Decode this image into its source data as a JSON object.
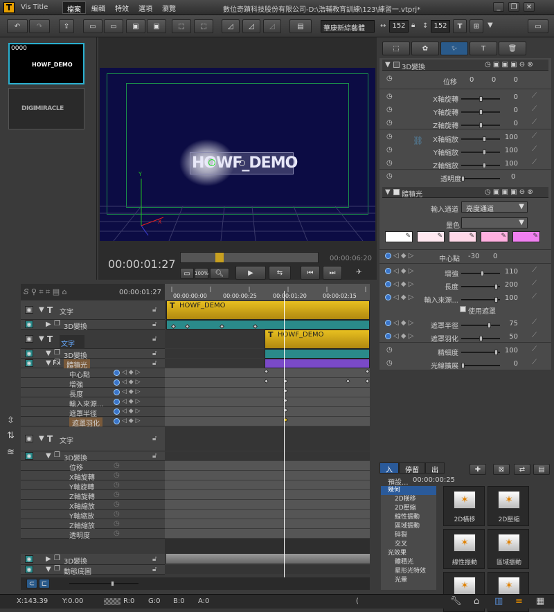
{
  "app": {
    "logo": "T",
    "title": "Vis Title",
    "menu": [
      "檔案",
      "編輯",
      "特效",
      "選項",
      "瀏覽"
    ],
    "window_title": "數位奇蹟科技股份有限公司-D:\\浩輔教育訓練\\123\\練習一.vtprj*"
  },
  "toolbar": {
    "font_name": "華康新綜藝體",
    "font_width": "152",
    "font_height": "152"
  },
  "thumbs": [
    {
      "index": "0000",
      "label": "HOWF_DEMO"
    },
    {
      "label": "DIGIMIRACLE"
    }
  ],
  "preview": {
    "text": "HOWF_DEMO",
    "timecode": "00:00:01:27",
    "end_time": "00:00:06:20",
    "zoom_badge": "100%",
    "axis_y": "Y",
    "axis_x": "X"
  },
  "right": {
    "section1_title": "3D變換",
    "position_label": "位移",
    "position_values": [
      "0",
      "0",
      "0"
    ],
    "rows1": [
      {
        "label": "X軸旋轉",
        "value": "0",
        "level": 0.5
      },
      {
        "label": "Y軸旋轉",
        "value": "0",
        "level": 0.5
      },
      {
        "label": "Z軸旋轉",
        "value": "0",
        "level": 0.5
      }
    ],
    "rows2": [
      {
        "label": "X軸縮放",
        "value": "100",
        "level": 0.6
      },
      {
        "label": "Y軸縮放",
        "value": "100",
        "level": 0.6
      },
      {
        "label": "Z軸縮放",
        "value": "100",
        "level": 0.6
      }
    ],
    "opacity_label": "透明度",
    "opacity_value": "0",
    "section2_title": "體積光",
    "input_channel_label": "輸入通道",
    "input_channel_value": "亮度通道",
    "color_label": "量色",
    "center_label": "中心點",
    "center_x": "-30",
    "center_y": "0",
    "rows3": [
      {
        "label": "增強",
        "value": "110",
        "level": 0.55
      },
      {
        "label": "長度",
        "value": "200",
        "level": 0.95
      },
      {
        "label": "輸入來源...",
        "value": "100",
        "level": 0.95
      }
    ],
    "use_mask_label": "使用遮罩",
    "rows4": [
      {
        "label": "遮罩半徑",
        "value": "75",
        "level": 0.75
      },
      {
        "label": "遮罩羽化",
        "value": "50",
        "level": 0.5
      }
    ],
    "rows5": [
      {
        "label": "精細度",
        "value": "100",
        "level": 0.95
      },
      {
        "label": "光線擴展",
        "value": "0",
        "level": 0.0
      }
    ],
    "swatches": [
      "#ffffff",
      "#ffe8f0",
      "#ffd8e8",
      "#ffb0e0",
      "#f080f0"
    ]
  },
  "timeline": {
    "header_time": "00:00:01:27",
    "ruler": [
      "00:00:00:00",
      "00:00:00:25",
      "00:00:01:20",
      "00:00:02:15"
    ],
    "clip1_label": "HOWF_DEMO",
    "clip2_label": "HOWF_DEMO",
    "tracks": [
      {
        "name": "文字",
        "indent": 0
      },
      {
        "name": "3D變換",
        "indent": 1
      },
      {
        "name": "文字",
        "indent": 0
      },
      {
        "name": "3D變換",
        "indent": 1
      },
      {
        "name": "體積光",
        "indent": 1
      },
      {
        "name": "中心點",
        "indent": 2
      },
      {
        "name": "增強",
        "indent": 2
      },
      {
        "name": "長度",
        "indent": 2
      },
      {
        "name": "輸入來源...",
        "indent": 2
      },
      {
        "name": "遮罩半徑",
        "indent": 2
      },
      {
        "name": "遮罩羽化",
        "indent": 2
      },
      {
        "name": "文字",
        "indent": 0
      },
      {
        "name": "3D變換",
        "indent": 1
      },
      {
        "name": "位移",
        "indent": 2
      },
      {
        "name": "X軸旋轉",
        "indent": 2
      },
      {
        "name": "Y軸旋轉",
        "indent": 2
      },
      {
        "name": "Z軸旋轉",
        "indent": 2
      },
      {
        "name": "X軸縮放",
        "indent": 2
      },
      {
        "name": "Y軸縮放",
        "indent": 2
      },
      {
        "name": "Z軸縮放",
        "indent": 2
      },
      {
        "name": "透明度",
        "indent": 2
      },
      {
        "name": "3D變換",
        "indent": 1
      },
      {
        "name": "動態底圖",
        "indent": 1
      }
    ],
    "fx_label": "Fx"
  },
  "library": {
    "tabs": [
      "入",
      "停留",
      "出"
    ],
    "preset_label": "預設...",
    "preset_time": "00:00:00:25",
    "categories": [
      {
        "label": "幾何",
        "header": true
      },
      {
        "label": "2D橫移"
      },
      {
        "label": "2D壓縮"
      },
      {
        "label": "線性振動"
      },
      {
        "label": "區域振動"
      },
      {
        "label": "碎裂"
      },
      {
        "label": "交叉"
      },
      {
        "label": "光效果",
        "header": true
      },
      {
        "label": "體積光"
      },
      {
        "label": "星形光特效"
      },
      {
        "label": "光暈"
      }
    ],
    "tiles": [
      "2D橫移",
      "2D壓縮",
      "線性振動",
      "區域振動",
      "",
      ""
    ]
  },
  "status": {
    "x": "X:143.39",
    "y": "Y:0.00",
    "r": "R:0",
    "g": "G:0",
    "b": "B:0",
    "a": "A:0",
    "paren": "("
  }
}
